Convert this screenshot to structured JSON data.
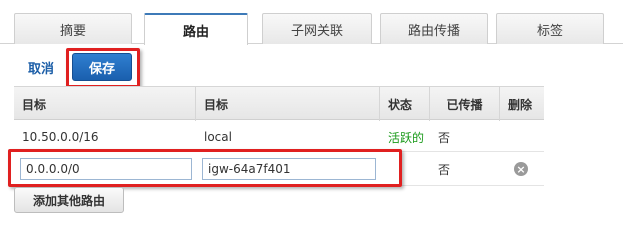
{
  "tabs": [
    {
      "label": "摘要",
      "active": false
    },
    {
      "label": "路由",
      "active": true
    },
    {
      "label": "子网关联",
      "active": false
    },
    {
      "label": "路由传播",
      "active": false
    },
    {
      "label": "标签",
      "active": false
    }
  ],
  "actions": {
    "cancel_label": "取消",
    "save_label": "保存"
  },
  "table": {
    "headers": [
      "目标",
      "目标",
      "状态",
      "已传播",
      "删除"
    ],
    "rows": [
      {
        "destination": "10.50.0.0/16",
        "target": "local",
        "status": "活跃的",
        "propagated": "否"
      }
    ],
    "new_row": {
      "destination": "0.0.0.0/0",
      "target": "igw-64a7f401",
      "propagated": "否",
      "remove_icon": "close-circle-icon"
    }
  },
  "add_route_label": "添加其他路由",
  "colors": {
    "accent": "#1d5fa8",
    "highlight": "#e02020",
    "status_active": "#1a9a1a"
  }
}
